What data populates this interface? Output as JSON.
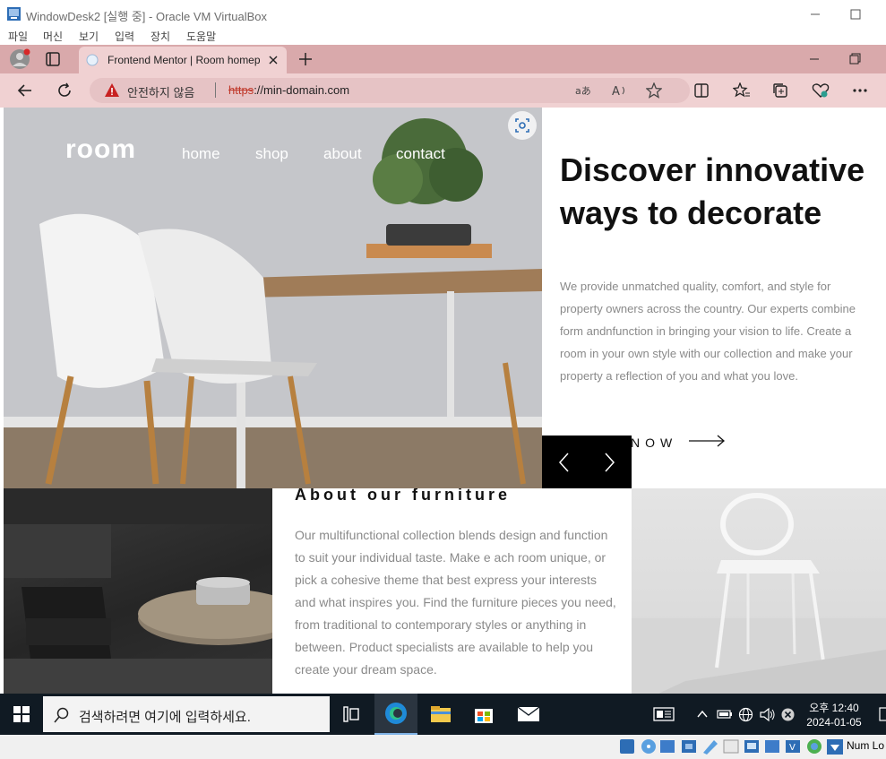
{
  "vbox": {
    "title": "WindowDesk2 [실행 중] - Oracle VM VirtualBox",
    "menu": [
      "파일",
      "머신",
      "보기",
      "입력",
      "장치",
      "도움말"
    ]
  },
  "browser": {
    "tab_title": "Frontend Mentor | Room homep",
    "security_label": "안전하지 않음",
    "url_scheme": "https",
    "url_rest": "://min-domain.com"
  },
  "site": {
    "logo": "room",
    "nav": [
      "home",
      "shop",
      "about",
      "contact"
    ],
    "hero_title": "Discover innovative ways to decorate",
    "hero_desc": "We provide unmatched quality, comfort, and style for property owners across the country. Our experts combine form andnfunction in bringing your vision to life. Create a room in your own style with our collection and make your property a reflection of you and what you love.",
    "shop_now": "NOW",
    "about_title": "About our furniture",
    "about_text": "Our multifunctional collection blends design and function to suit your individual taste. Make e ach room unique, or pick a cohesive theme that best express your interests and what inspires you. Find the furniture pieces you need, from traditional to contemporary styles or anything in between. Product specialists are available to help you create your dream space."
  },
  "taskbar": {
    "search_placeholder": "검색하려면 여기에 입력하세요.",
    "time_period": "오후 12:40",
    "date": "2024-01-05"
  },
  "statusbar": {
    "numlock": "Num Lo"
  },
  "colors": {
    "edge_tabstrip": "#d9a9ab",
    "edge_toolbar": "#f0d1d2",
    "taskbar": "#101a23",
    "slider_bg": "#000000"
  }
}
